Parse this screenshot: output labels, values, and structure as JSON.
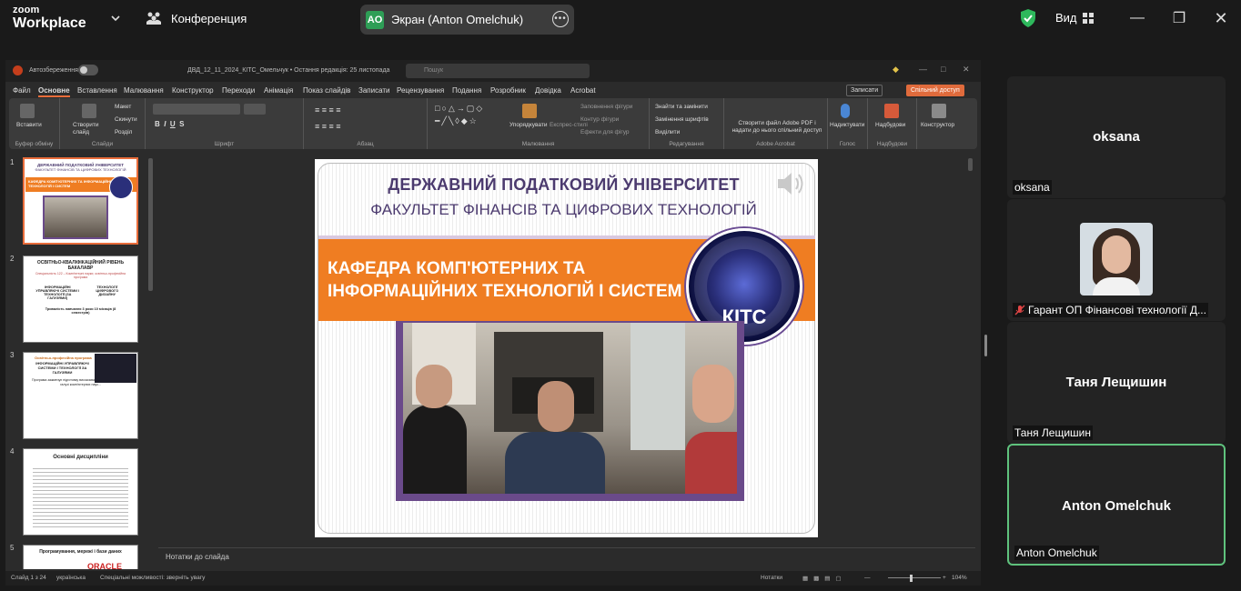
{
  "zoom": {
    "logo_line1": "zoom",
    "logo_line2": "Workplace",
    "meeting_label": "Конференция",
    "share": {
      "initials": "AO",
      "label": "Экран (Anton Omelchuk)"
    },
    "view_label": "Вид",
    "colors": {
      "accent_green": "#2e9e56",
      "active_border": "#5fc27d"
    }
  },
  "ppt": {
    "autosave": "Автозбереження",
    "filename": "ДВД_12_11_2024_КІТС_Омельчук  •  Остання редакція: 25 листопада",
    "search_placeholder": "Пошук",
    "tabs": [
      "Файл",
      "Основне",
      "Вставлення",
      "Малювання",
      "Конструктор",
      "Переходи",
      "Анімація",
      "Показ слайдів",
      "Записати",
      "Рецензування",
      "Подання",
      "Розробник",
      "Довідка",
      "Acrobat"
    ],
    "record_btn": "Записати",
    "share_btn": "Спільний доступ",
    "ribbon": {
      "paste": "Вставити",
      "new_slide": "Створити слайд",
      "layout": "Макет",
      "reset": "Скинути",
      "section": "Розділ",
      "replace_shapes": "Заповнення фігури",
      "outline": "Контур фігури",
      "effects": "Ефекти для фігур",
      "arrange": "Упорядкувати",
      "quick_styles": "Експрес-стилі",
      "find_replace": "Знайти та замінити",
      "replace_fonts": "Замінення шрифтів",
      "select": "Виділити",
      "adobe": "Створити файл Adobe PDF і надати до нього спільний доступ",
      "dictate": "Надиктувати",
      "addins": "Надбудови",
      "designer": "Конструктор",
      "groups": {
        "clipboard": "Буфер обміну",
        "slides": "Слайди",
        "font": "Шрифт",
        "paragraph": "Абзац",
        "drawing": "Малювання",
        "editing": "Редагування",
        "acrobat": "Adobe Acrobat",
        "voice": "Голос",
        "addins": "Надбудови"
      }
    },
    "thumbnails": [
      {
        "num": "1",
        "line1": "ДЕРЖАВНИЙ ПОДАТКОВИЙ УНІВЕРСИТЕТ",
        "line2": "ФАКУЛЬТЕТ ФІНАНСІВ ТА ЦИФРОВИХ ТЕХНОЛОГІЙ",
        "band": "КАФЕДРА КОМП'ЮТЕРНИХ ТА ІНФОРМАЦІЙНИХ ТЕХНОЛОГІЙ І СИСТЕМ"
      },
      {
        "num": "2",
        "title": "ОСВІТНЬО-КВАЛІФІКАЦІЙНИЙ РІВЕНЬ БАКАЛАВР",
        "subtitle": "Спеціальність 122 – Комп'ютерні науки; освітньо-професійна програма",
        "left": "ІНФОРМАЦІЙНІ УПРАВЛЯЮЧІ СИСТЕМИ І ТЕХНОЛОГІЇ (ЗА ГАЛУЗЯМИ)",
        "right": "ТЕХНОЛОГІЇ ЦИФРОВОГО ДИЗАЙНУ",
        "footer": "Тривалість навчання 3 роки 10 місяців (8 семестрів)"
      },
      {
        "num": "3",
        "title": "Освітньо-професійна програма",
        "sub": "ІНФОРМАЦІЙНІ УПРАВЛЯЮЧІ СИСТЕМИ І ТЕХНОЛОГІЇ ЗА ГАЛУЗЯМИ",
        "body": "Програма зажмечує підготовку висококваліфікованих фахівців в галузі комп'ютерних наук..."
      },
      {
        "num": "4",
        "title": "Основні дисципліни"
      },
      {
        "num": "5",
        "title": "Програмування, мережі і бази даних",
        "logo": "ORACLE"
      }
    ],
    "slide": {
      "title1": "ДЕРЖАВНИЙ ПОДАТКОВИЙ УНІВЕРСИТЕТ",
      "title2": "ФАКУЛЬТЕТ ФІНАНСІВ ТА ЦИФРОВИХ ТЕХНОЛОГІЙ",
      "band_line1": "КАФЕДРА КОМП'ЮТЕРНИХ ТА",
      "band_line2": "ІНФОРМАЦІЙНИХ ТЕХНОЛОГІЙ І СИСТЕМ",
      "logo_text": "КІТС",
      "colors": {
        "band": "#ef7d22",
        "title": "#4b3a6e",
        "frame": "#6a4a8a"
      }
    },
    "notes_placeholder": "Нотатки до слайда",
    "status": {
      "slide_count": "Слайд 1 з 24",
      "language": "українська",
      "accessibility": "Спеціальні можливості: зверніть увагу",
      "notes": "Нотатки",
      "zoom": "104%"
    }
  },
  "participants": [
    {
      "display": "oksana",
      "label": "oksana",
      "type": "name"
    },
    {
      "display": "",
      "label": "Гарант ОП Фінансові технології Д...",
      "type": "photo",
      "muted": true
    },
    {
      "display": "Таня Лещишин",
      "label": "Таня Лещишин",
      "type": "name"
    },
    {
      "display": "Anton Omelchuk",
      "label": "Anton Omelchuk",
      "type": "name",
      "active": true
    }
  ]
}
